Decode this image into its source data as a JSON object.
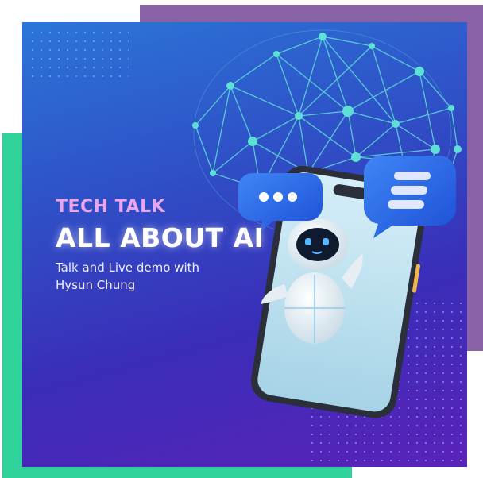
{
  "poster": {
    "kicker": "TECH TALK",
    "headline": "ALL ABOUT AI",
    "subtitle_line1": "Talk and Live demo with",
    "subtitle_line2": "Hysun Chung"
  },
  "colors": {
    "gradient_top": "#2b76d8",
    "gradient_bottom": "#5a22b8",
    "kicker": "#e9a6ef",
    "accent_green": "#2fd39a",
    "accent_purple": "#8a63a6",
    "network": "#5ee0d6",
    "bubble_blue": "#2a64e6"
  },
  "icons": [
    "network-globe-icon",
    "chat-bubble-dots-icon",
    "chat-bubble-lines-icon",
    "robot-icon",
    "smartphone-icon"
  ]
}
